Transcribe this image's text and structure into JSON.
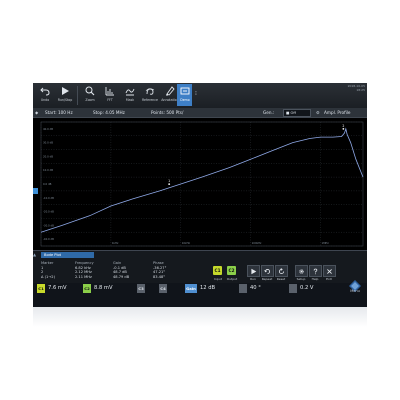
{
  "datetime": [
    "2018-10-05",
    "18:25"
  ],
  "toolbar": {
    "items": [
      {
        "label": "Undo",
        "icon": "undo-icon"
      },
      {
        "label": "Run/Stop",
        "icon": "play-icon"
      },
      {
        "label": "Zoom",
        "icon": "zoom-icon"
      },
      {
        "label": "FFT",
        "icon": "fft-icon"
      },
      {
        "label": "Mask",
        "icon": "mask-icon"
      },
      {
        "label": "Reference",
        "icon": "reference-icon"
      },
      {
        "label": "Annotation",
        "icon": "annotation-icon"
      },
      {
        "label": "Demo",
        "icon": "demo-icon"
      }
    ],
    "more_icon": "more-dots-icon"
  },
  "infobar": {
    "start": "Start: 100 Hz",
    "stop": "Stop: 4.05 MHz",
    "points": "Points: 500 Pts/",
    "gen_label": "Gen.:",
    "gen_value": "■ Off",
    "profile": "Ampl. Profile"
  },
  "plot": {
    "y_ticks": [
      "40.0 dB",
      "30.0 dB",
      "20.0 dB",
      "10.0 dB",
      "0.0 dB",
      "-10.0 dB",
      "-20.0 dB",
      "-30.0 dB",
      "-40.0 dB"
    ],
    "x_ticks": [
      "1kHz",
      "10kHz",
      "100kHz",
      "1MHz"
    ],
    "markers": [
      "1",
      "2"
    ],
    "trace_color": "#8fa9e8"
  },
  "chart_data": {
    "type": "line",
    "xscale": "log",
    "xlim": [
      100,
      4050000
    ],
    "ylim": [
      -45,
      45
    ],
    "series": [
      {
        "x": [
          100,
          200,
          500,
          1000,
          2000,
          5000,
          10000,
          20000,
          50000,
          100000,
          200000,
          400000,
          700000,
          1000000,
          1500000,
          2000000,
          2200000,
          2300000,
          2400000,
          2700000,
          3200000,
          4050000
        ],
        "y": [
          -35,
          -30,
          -23,
          -16,
          -11,
          -5,
          0,
          5,
          12,
          18,
          24,
          30,
          33,
          34,
          34,
          34.5,
          37,
          40,
          36,
          30,
          18,
          5
        ]
      }
    ]
  },
  "bode": {
    "tab": "Bode Plot",
    "headers": [
      "Marker",
      "Frequency",
      "Gain",
      "Phase"
    ],
    "rows": [
      [
        "1",
        "6.82 kHz",
        "-0.1 dB",
        "-36.27°"
      ],
      [
        "2",
        "2.12 MHz",
        "48.7 dB",
        "47.21°"
      ],
      [
        "Δ (1→2)",
        "2.11 MHz",
        "48.79 dB",
        "83.48°"
      ]
    ]
  },
  "controls": {
    "c1": "C1",
    "c2": "C2",
    "input_lbl": "Input",
    "output_lbl": "Output",
    "buttons": [
      {
        "label": "Run",
        "icon": "run-icon"
      },
      {
        "label": "Repeat",
        "icon": "repeat-icon"
      },
      {
        "label": "Reset",
        "icon": "reset-icon"
      },
      {
        "label": "Setup",
        "icon": "setup-gear-icon"
      },
      {
        "label": "Help",
        "icon": "help-icon"
      },
      {
        "label": "Exit",
        "icon": "exit-icon"
      }
    ]
  },
  "statusbar": [
    {
      "tag": "C1",
      "value": "7.6 mV",
      "color": "#c8da2b"
    },
    {
      "tag": "C2",
      "value": "8.8 mV",
      "color": "#8bcf49"
    },
    {
      "tag": "C3",
      "value": "",
      "color": "#5a616b"
    },
    {
      "tag": "C4",
      "value": "",
      "color": "#5a616b"
    },
    {
      "tag": "Gain",
      "value": "12 dB",
      "color": "#4f8fd0"
    },
    {
      "tag": "",
      "value": "40 °",
      "color": "#5a616b"
    },
    {
      "tag": "",
      "value": "0.2 V",
      "color": "#5a616b"
    }
  ],
  "logo": "Menu"
}
